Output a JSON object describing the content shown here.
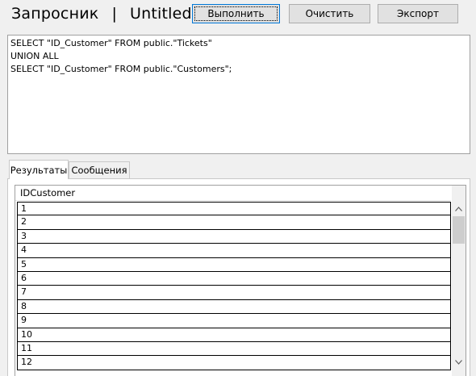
{
  "app": {
    "name": "Запросник",
    "separator": "|",
    "document": "Untitled"
  },
  "toolbar": {
    "execute_label": "Выполнить",
    "clear_label": "Очистить",
    "export_label": "Экспорт"
  },
  "editor": {
    "lines": [
      "SELECT \"ID_Customer\" FROM public.\"Tickets\"",
      "UNION ALL",
      "SELECT \"ID_Customer\" FROM public.\"Customers\";"
    ]
  },
  "tabs": {
    "results_label": "Результаты",
    "messages_label": "Сообщения",
    "active": "results"
  },
  "grid": {
    "columns": [
      "IDCustomer"
    ],
    "rows": [
      "1",
      "2",
      "3",
      "4",
      "5",
      "6",
      "7",
      "8",
      "9",
      "10",
      "11",
      "12"
    ]
  },
  "icons": {
    "scroll_up": "chevron-up-icon",
    "scroll_down": "chevron-down-icon"
  },
  "colors": {
    "default_button_border": "#0078d7",
    "button_bg": "#e1e1e1",
    "window_bg": "#f0f0f0"
  }
}
